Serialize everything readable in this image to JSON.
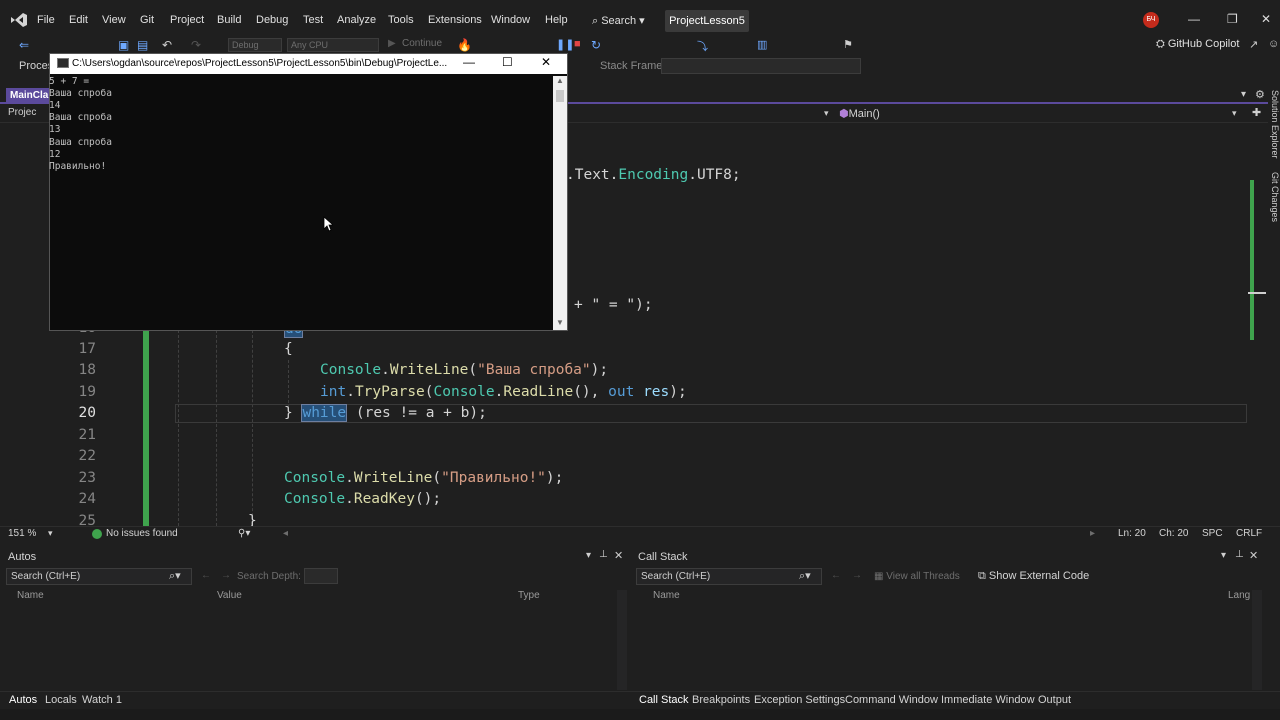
{
  "menubar": {
    "items": [
      "File",
      "Edit",
      "View",
      "Git",
      "Project",
      "Build",
      "Debug",
      "Test",
      "Analyze",
      "Tools",
      "Extensions",
      "Window",
      "Help"
    ],
    "search": "Search",
    "project_tab": "ProjectLesson5",
    "avatar": "БЧ"
  },
  "toolbar": {
    "config": "Debug",
    "platform": "Any CPU",
    "continue": "Continue",
    "copilot": "GitHub Copilot"
  },
  "debug_strip": {
    "process_label": "Proces",
    "stack_frame_label": "Stack Frame:"
  },
  "document": {
    "tab": "MainCla",
    "project_nav": "Projec",
    "method_nav": "Main()"
  },
  "side_panels": [
    "Solution Explorer",
    "Git Changes"
  ],
  "editor": {
    "visible_fragments": {
      "line_a": {
        "pre": ".Text.",
        "type": "Encoding",
        "post": ".UTF8;"
      },
      "line_b": "+ \" = \");"
    },
    "lines": [
      {
        "num": "16",
        "text": "do"
      },
      {
        "num": "17",
        "text": "{"
      },
      {
        "num": "18",
        "obj": "Console",
        "method": "WriteLine",
        "str": "\"Ваша спроба\""
      },
      {
        "num": "19",
        "kw": "int",
        "method": "TryParse",
        "obj": "Console",
        "method2": "ReadLine",
        "kw2": "out",
        "var": "res"
      },
      {
        "num": "20",
        "kw": "while",
        "cond": "(res != a + b);"
      },
      {
        "num": "21"
      },
      {
        "num": "22"
      },
      {
        "num": "23",
        "obj": "Console",
        "method": "WriteLine",
        "str": "\"Правильно!\""
      },
      {
        "num": "24",
        "obj": "Console",
        "method": "ReadKey"
      },
      {
        "num": "25",
        "text": "}"
      }
    ]
  },
  "editor_status": {
    "zoom": "151 %",
    "issues": "No issues found",
    "line": "Ln: 20",
    "col": "Ch: 20",
    "spc": "SPC",
    "eol": "CRLF"
  },
  "console": {
    "title": "C:\\Users\\ogdan\\source\\repos\\ProjectLesson5\\ProjectLesson5\\bin\\Debug\\ProjectLe...",
    "lines": [
      "5 + 7 =",
      "Ваша спроба",
      "14",
      "Ваша спроба",
      "13",
      "Ваша спроба",
      "12",
      "Правильно!"
    ]
  },
  "autos": {
    "title": "Autos",
    "search": "Search (Ctrl+E)",
    "search_depth": "Search Depth:",
    "columns": [
      "Name",
      "Value",
      "Type"
    ]
  },
  "callstack": {
    "title": "Call Stack",
    "search": "Search (Ctrl+E)",
    "view_threads": "View all Threads",
    "show_external": "Show External Code",
    "columns": [
      "Name",
      "Lang"
    ]
  },
  "bottom_tabs_left": [
    "Autos",
    "Locals",
    "Watch 1"
  ],
  "bottom_tabs_right": [
    "Call Stack",
    "Breakpoints",
    "Exception Settings",
    "Command Window",
    "Immediate Window",
    "Output"
  ]
}
